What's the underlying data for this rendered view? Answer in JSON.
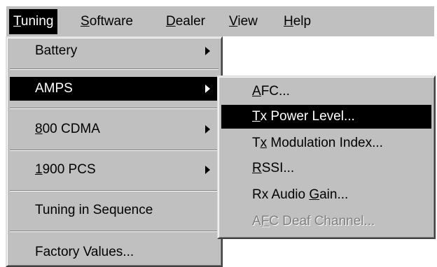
{
  "menubar": {
    "items": [
      {
        "mnemonic": "T",
        "rest": "uning"
      },
      {
        "mnemonic": "S",
        "rest": "oftware"
      },
      {
        "mnemonic": "D",
        "rest": "ealer"
      },
      {
        "mnemonic": "V",
        "rest": "iew"
      },
      {
        "mnemonic": "H",
        "rest": "elp"
      }
    ]
  },
  "tuning_menu": {
    "items": [
      {
        "label": "Battery"
      },
      {
        "label": "AMPS"
      },
      {
        "mnemonic": "8",
        "rest": "00 CDMA"
      },
      {
        "mnemonic": "1",
        "rest": "900 PCS"
      },
      {
        "label": "Tuning in Sequence"
      },
      {
        "label": "Factory Values..."
      }
    ]
  },
  "amps_submenu": {
    "items": [
      {
        "mnemonic": "A",
        "rest": "FC..."
      },
      {
        "mnemonic": "T",
        "rest": "x Power Level..."
      },
      {
        "before": "T",
        "mnemonic": "x",
        "rest": " Modulation Index..."
      },
      {
        "mnemonic": "R",
        "rest": "SSI..."
      },
      {
        "before": "Rx Audio ",
        "mnemonic": "G",
        "rest": "ain..."
      },
      {
        "before": "A",
        "mnemonic": "F",
        "rest": "C Deaf Channel..."
      }
    ]
  }
}
